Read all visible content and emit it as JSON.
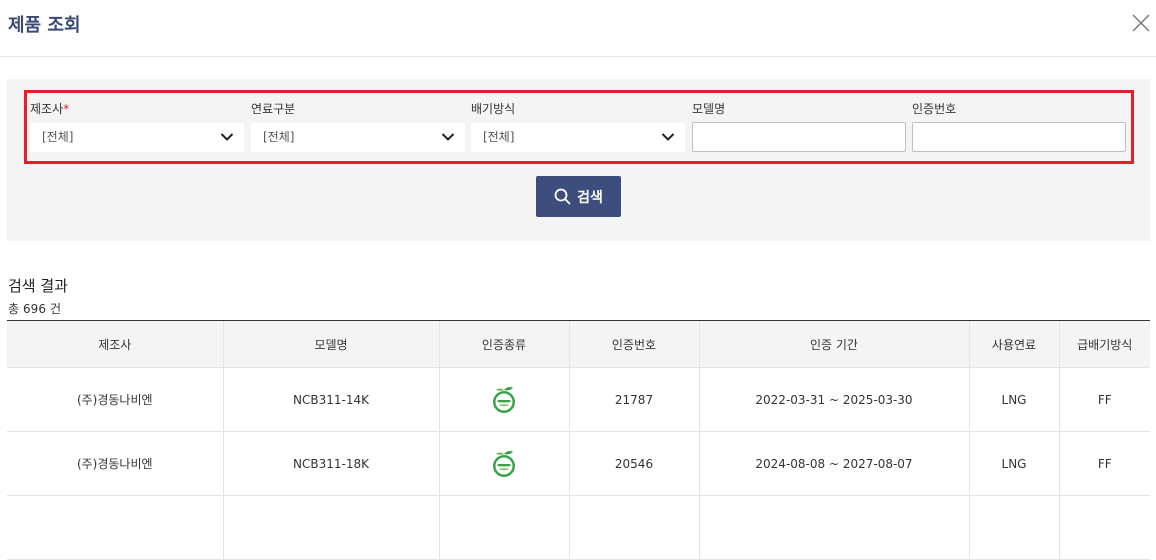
{
  "header": {
    "title": "제품 조회"
  },
  "filters": {
    "manufacturer": {
      "label": "제조사",
      "required_mark": "*",
      "value": "[전체]"
    },
    "fuel": {
      "label": "연료구분",
      "value": "[전체]"
    },
    "exhaust": {
      "label": "배기방식",
      "value": "[전체]"
    },
    "model": {
      "label": "모델명",
      "value": ""
    },
    "cert_no": {
      "label": "인증번호",
      "value": ""
    },
    "search_button": "검색"
  },
  "results": {
    "title": "검색 결과",
    "count_prefix": "총",
    "count": "696",
    "count_suffix": "건",
    "columns": [
      "제조사",
      "모델명",
      "인증종류",
      "인증번호",
      "인증 기간",
      "사용연료",
      "급배기방식"
    ],
    "rows": [
      {
        "manufacturer": "(주)경동나비엔",
        "model": "NCB311-14K",
        "cert_type_icon": "eco-certification-badge-icon",
        "cert_no": "21787",
        "period": "2022-03-31 ~ 2025-03-30",
        "fuel": "LNG",
        "exhaust": "FF"
      },
      {
        "manufacturer": "(주)경동나비엔",
        "model": "NCB311-18K",
        "cert_type_icon": "eco-certification-badge-icon",
        "cert_no": "20546",
        "period": "2024-08-08 ~ 2027-08-07",
        "fuel": "LNG",
        "exhaust": "FF"
      },
      {
        "manufacturer": "",
        "model": "",
        "cert_type_icon": "",
        "cert_no": "",
        "period": "",
        "fuel": "",
        "exhaust": ""
      }
    ]
  },
  "colors": {
    "primary": "#3d4d7e",
    "title": "#3a4a74",
    "highlight": "#e0202a",
    "eco_green": "#3aa24a"
  }
}
